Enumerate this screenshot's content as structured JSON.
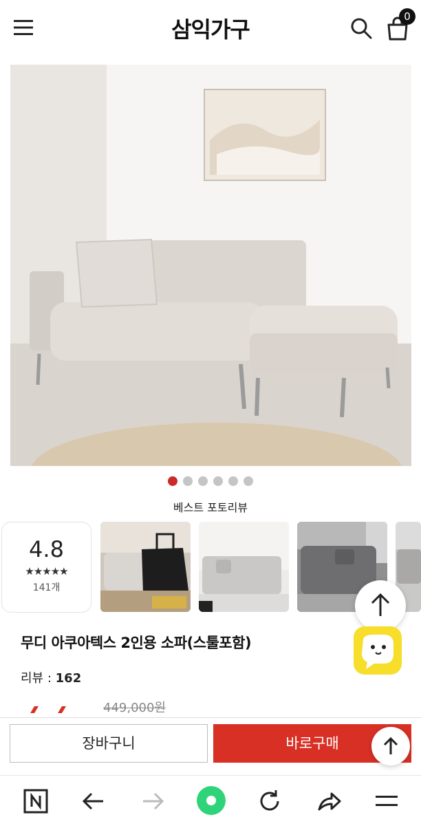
{
  "header": {
    "brand": "삼익가구",
    "cart_count": "0"
  },
  "gallery": {
    "dot_count": 6,
    "active_index": 0
  },
  "reviews": {
    "section_title": "베스트 포토리뷰",
    "rating": "4.8",
    "stars": "★★★★★",
    "count": "141개"
  },
  "product": {
    "name": "무디 아쿠아텍스 2인용 소파(스툴포함)",
    "review_label": "리뷰 : ",
    "review_count": "162",
    "old_price": "449,000원"
  },
  "actions": {
    "cart_label": "장바구니",
    "buy_label": "바로구매"
  },
  "colors": {
    "accent_red": "#d93025",
    "dot_active": "#cc2a2a",
    "chat_yellow": "#f7de2b"
  },
  "icons": [
    "menu-icon",
    "search-icon",
    "shopping-bag-icon",
    "arrow-up-icon",
    "chat-icon",
    "naver-n-icon",
    "back-arrow-icon",
    "forward-arrow-icon",
    "home-green-icon",
    "refresh-icon",
    "share-icon",
    "hamburger-icon"
  ]
}
